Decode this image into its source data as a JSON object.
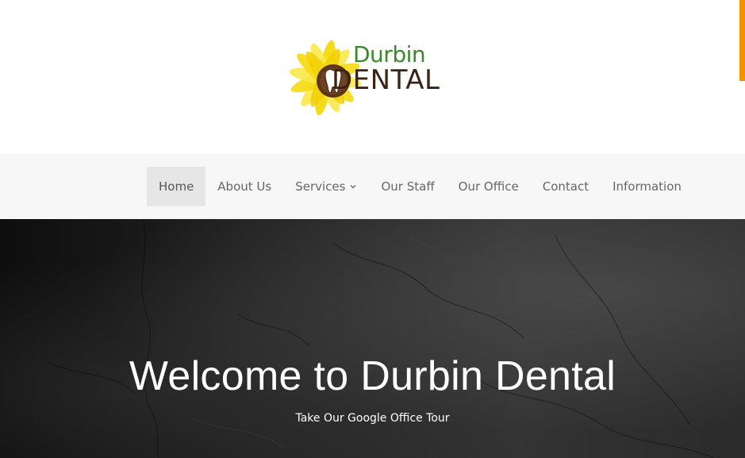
{
  "brand": {
    "name_top": "Durbin",
    "name_bottom": "DENTAL",
    "logo_icon": "sunflower-tooth-icon",
    "colors": {
      "green": "#3a8a2a",
      "brown": "#3b2314",
      "petal_yellow": "#f5d90f",
      "petal_light": "#f9e84a",
      "accent_orange": "#f39200"
    }
  },
  "nav": {
    "items": [
      {
        "label": "Home",
        "active": true
      },
      {
        "label": "About Us"
      },
      {
        "label": "Services",
        "icon": "chevron-down-icon"
      },
      {
        "label": "Our Staff"
      },
      {
        "label": "Our Office"
      },
      {
        "label": "Contact"
      },
      {
        "label": "Information"
      }
    ]
  },
  "hero": {
    "title": "Welcome to Durbin Dental",
    "link_label": "Take Our Google Office Tour"
  }
}
